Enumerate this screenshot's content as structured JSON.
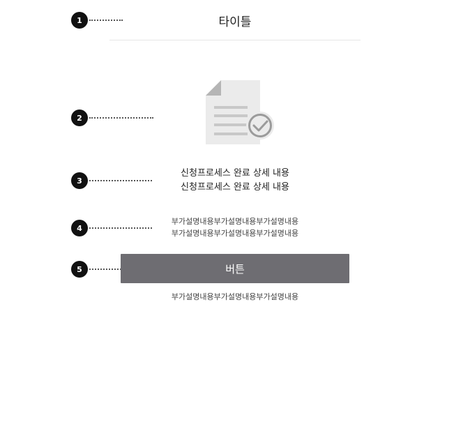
{
  "markers": [
    "1",
    "2",
    "3",
    "4",
    "5"
  ],
  "header": {
    "title": "타이틀"
  },
  "icon": {
    "name": "document-check-icon"
  },
  "content": {
    "main_lines": [
      "신청프로세스 완료 상세 내용",
      "신청프로세스 완료 상세 내용"
    ],
    "sub_lines": [
      "부가설명내용부가설명내용부가설명내용",
      "부가설명내용부가설명내용부가설명내용"
    ]
  },
  "button": {
    "label": "버튼"
  },
  "footer": {
    "text": "부가설명내용부가설명내용부가설명내용"
  },
  "colors": {
    "button_bg": "#6e6d72",
    "marker_bg": "#111111",
    "icon_gray": "#ebebeb"
  }
}
